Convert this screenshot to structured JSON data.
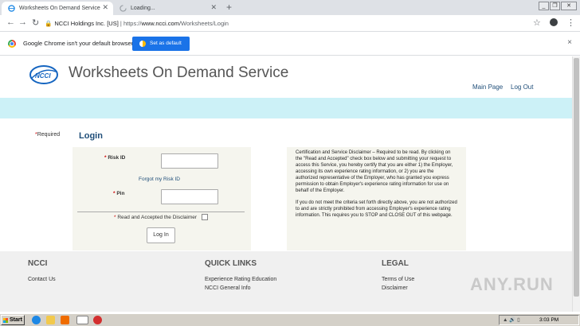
{
  "browser": {
    "tabs": [
      {
        "label": "Worksheets On Demand Service",
        "active": true
      },
      {
        "label": "Loading...",
        "active": false
      }
    ],
    "new_tab": "+",
    "address": {
      "site_identity": "NCCI Holdings Inc. [US]",
      "separator": "|",
      "url_scheme": "https://",
      "url_host": "www.ncci.com",
      "url_path": "/Worksheets/Login"
    },
    "infobar": {
      "message": "Google Chrome isn't your default browser",
      "button": "Set as default",
      "close": "×"
    },
    "glyphs": {
      "back": "←",
      "forward": "→",
      "reload": "↻",
      "star": "☆",
      "menu": "⋮",
      "tab_close": "✕"
    }
  },
  "header": {
    "title": "Worksheets On Demand Service",
    "links": [
      "Main Page",
      "Log Out"
    ],
    "band_color": "#ccf1f7"
  },
  "login": {
    "required_note": "Required",
    "required_star": "*",
    "heading": "Login",
    "risk_id_label": "Risk ID",
    "forgot_link": "Forgot my Risk ID",
    "pin_label": "Pin",
    "accept_label": "Read and Accepted the Disclaimer",
    "submit": "Log In"
  },
  "disclaimer": {
    "paragraph1": "Certification and Service Disclaimer – Required to be read. By clicking on the \"Read and Accepted\" check box below and submitting your request to access this Service, you hereby certify that you are either 1) the Employer, accessing its own experience rating information, or 2) you are the authorized representative of the Employer, who has granted you express permission to obtain Employer's experience rating information for use on behalf of the Employer.",
    "paragraph2": "If you do not meet the criteria set forth directly above, you are not authorized to and are strictly prohibited from accessing Employer's experience rating information. This requires you to STOP and CLOSE OUT of this webpage."
  },
  "footer": {
    "ncci": {
      "heading": "NCCI",
      "links": [
        "Contact Us"
      ]
    },
    "quick_links": {
      "heading": "QUICK LINKS",
      "links": [
        "Experience Rating Education",
        "NCCI General Info"
      ]
    },
    "legal": {
      "heading": "LEGAL",
      "links": [
        "Terms of Use",
        "Disclaimer"
      ]
    },
    "watermark": "ANY.RUN"
  },
  "taskbar": {
    "start": "Start",
    "time": "3:03 PM"
  },
  "colors": {
    "link": "#1f4e79",
    "required": "#cc0000",
    "chrome_blue": "#1a73e8"
  }
}
